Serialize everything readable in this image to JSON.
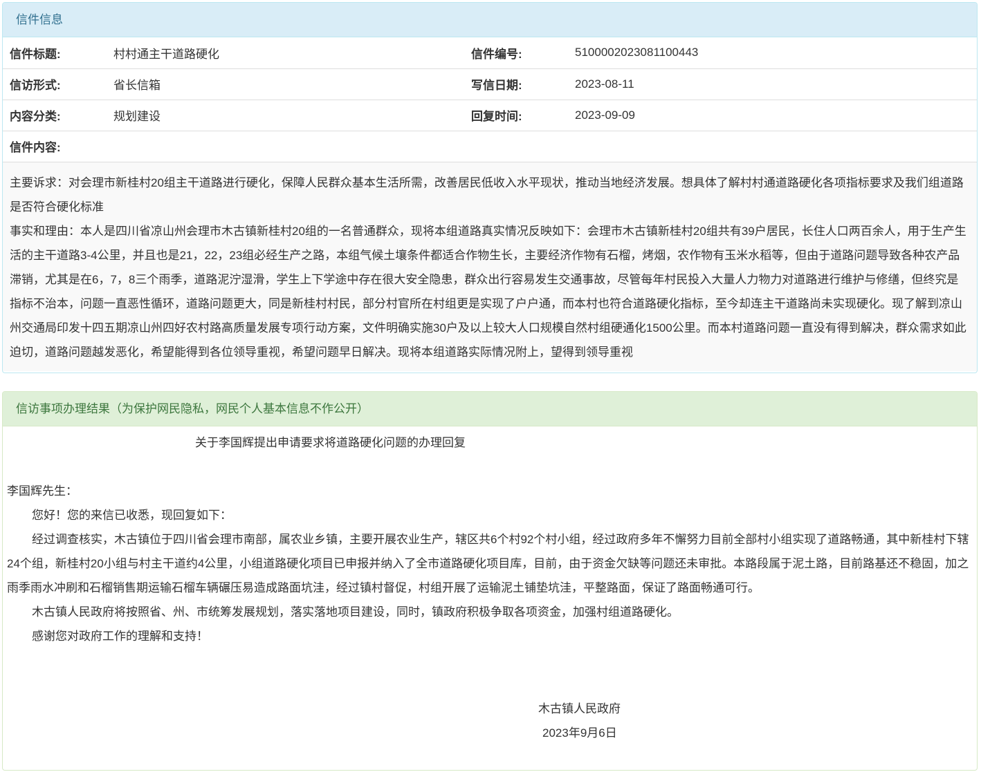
{
  "letter_info": {
    "heading": "信件信息",
    "rows": [
      {
        "label1": "信件标题:",
        "value1": "村村通主干道路硬化",
        "label2": "信件编号:",
        "value2": "5100002023081100443"
      },
      {
        "label1": "信访形式:",
        "value1": "省长信箱",
        "label2": "写信日期:",
        "value2": "2023-08-11"
      },
      {
        "label1": "内容分类:",
        "value1": "规划建设",
        "label2": "回复时间:",
        "value2": "2023-09-09"
      }
    ],
    "content_label": "信件内容:",
    "content_paragraphs": [
      "主要诉求：对会理市新桂村20组主干道路进行硬化，保障人民群众基本生活所需，改善居民低收入水平现状，推动当地经济发展。想具体了解村村通道路硬化各项指标要求及我们组道路是否符合硬化标准",
      "事实和理由：本人是四川省凉山州会理市木古镇新桂村20组的一名普通群众，现将本组道路真实情况反映如下：会理市木古镇新桂村20组共有39户居民，长住人口两百余人，用于生产生活的主干道路3-4公里，并且也是21，22，23组必经生产之路，本组气候土壤条件都适合作物生长，主要经济作物有石榴，烤烟，农作物有玉米水稻等，但由于道路问题导致各种农产品滞销，尤其是在6，7，8三个雨季，道路泥泞湿滑，学生上下学途中存在很大安全隐患，群众出行容易发生交通事故，尽管每年村民投入大量人力物力对道路进行维护与修缮，但终究是指标不治本，问题一直恶性循环，道路问题更大，同是新桂村村民，部分村官所在村组更是实现了户户通，而本村也符合道路硬化指标，至今却连主干道路尚未实现硬化。现了解到凉山州交通局印发十四五期凉山州四好农村路高质量发展专项行动方案，文件明确实施30户及以上较大人口规模自然村组硬通化1500公里。而本村道路问题一直没有得到解决，群众需求如此迫切，道路问题越发恶化，希望能得到各位领导重视，希望问题早日解决。现将本组道路实际情况附上，望得到领导重视"
    ]
  },
  "result": {
    "heading": "信访事项办理结果（为保护网民隐私，网民个人基本信息不作公开）",
    "title": "关于李国辉提出申请要求将道路硬化问题的办理回复",
    "salutation": "李国辉先生：",
    "paragraphs": [
      "您好！您的来信已收悉，现回复如下：",
      "经过调查核实，木古镇位于四川省会理市南部，属农业乡镇，主要开展农业生产，辖区共6个村92个村小组，经过政府多年不懈努力目前全部村小组实现了道路畅通，其中新桂村下辖24个组，新桂村20小组与村主干道约4公里，小组道路硬化项目已申报并纳入了全市道路硬化项目库，目前，由于资金欠缺等问题还未审批。本路段属于泥土路，目前路基还不稳固，加之雨季雨水冲刷和石榴销售期运输石榴车辆碾压易造成路面坑洼，经过镇村督促，村组开展了运输泥土铺垫坑洼，平整路面，保证了路面畅通可行。",
      "木古镇人民政府将按照省、州、市统筹发展规划，落实落地项目建设，同时，镇政府积极争取各项资金，加强村组道路硬化。",
      "感谢您对政府工作的理解和支持！"
    ],
    "signature": "木古镇人民政府",
    "date": "2023年9月6日"
  }
}
